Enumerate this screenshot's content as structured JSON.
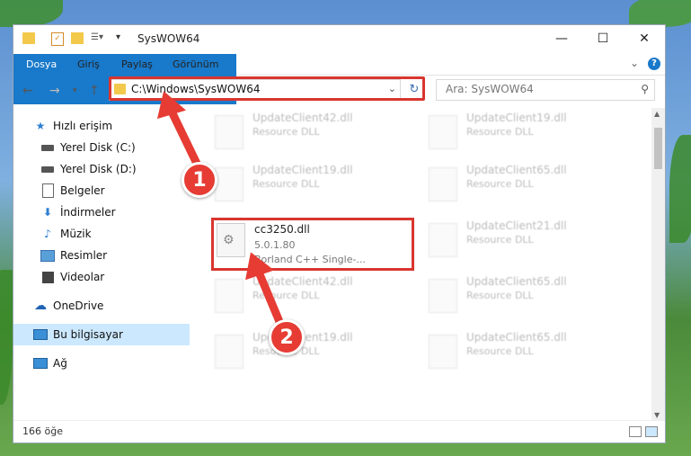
{
  "window": {
    "title": "SysWOW64",
    "minimize_label": "—",
    "maximize_label": "☐",
    "close_label": "✕"
  },
  "ribbon": {
    "tabs": [
      {
        "label": "Dosya"
      },
      {
        "label": "Giriş"
      },
      {
        "label": "Paylaş"
      },
      {
        "label": "Görünüm"
      }
    ],
    "collapse_label": "⌄",
    "help_label": "?"
  },
  "address": {
    "path": "C:\\Windows\\SysWOW64",
    "search_placeholder": "Ara: SysWOW64"
  },
  "sidebar": {
    "items": [
      {
        "label": "Hızlı erişim",
        "icon": "star-icon"
      },
      {
        "label": "Yerel Disk (C:)",
        "icon": "drive-icon"
      },
      {
        "label": "Yerel Disk (D:)",
        "icon": "drive-icon"
      },
      {
        "label": "Belgeler",
        "icon": "documents-icon"
      },
      {
        "label": "İndirmeler",
        "icon": "download-icon"
      },
      {
        "label": "Müzik",
        "icon": "music-icon"
      },
      {
        "label": "Resimler",
        "icon": "pictures-icon"
      },
      {
        "label": "Videolar",
        "icon": "video-icon"
      },
      {
        "label": "OneDrive",
        "icon": "cloud-icon"
      },
      {
        "label": "Bu bilgisayar",
        "icon": "computer-icon"
      },
      {
        "label": "Ağ",
        "icon": "network-icon"
      }
    ]
  },
  "files": [
    {
      "name": "UpdateClient42.dll",
      "desc": "Resource DLL"
    },
    {
      "name": "UpdateClient19.dll",
      "desc": "Resource DLL"
    },
    {
      "name": "UpdateClient19.dll",
      "desc": "Resource DLL"
    },
    {
      "name": "UpdateClient65.dll",
      "desc": "Resource DLL"
    },
    {
      "name": "cc3250.dll",
      "version": "5.0.1.80",
      "desc": "Borland C++ Single-..."
    },
    {
      "name": "UpdateClient21.dll",
      "desc": "Resource DLL"
    },
    {
      "name": "UpdateClient42.dll",
      "desc": "Resource DLL"
    },
    {
      "name": "UpdateClient65.dll",
      "desc": "Resource DLL"
    },
    {
      "name": "UpdateClient19.dll",
      "desc": "Resource DLL"
    },
    {
      "name": "UpdateClient65.dll",
      "desc": "Resource DLL"
    }
  ],
  "status": {
    "count": "166 öğe"
  },
  "callouts": [
    {
      "label": "1"
    },
    {
      "label": "2"
    }
  ],
  "colors": {
    "accent": "#1979ca",
    "highlight": "#d9352f"
  }
}
